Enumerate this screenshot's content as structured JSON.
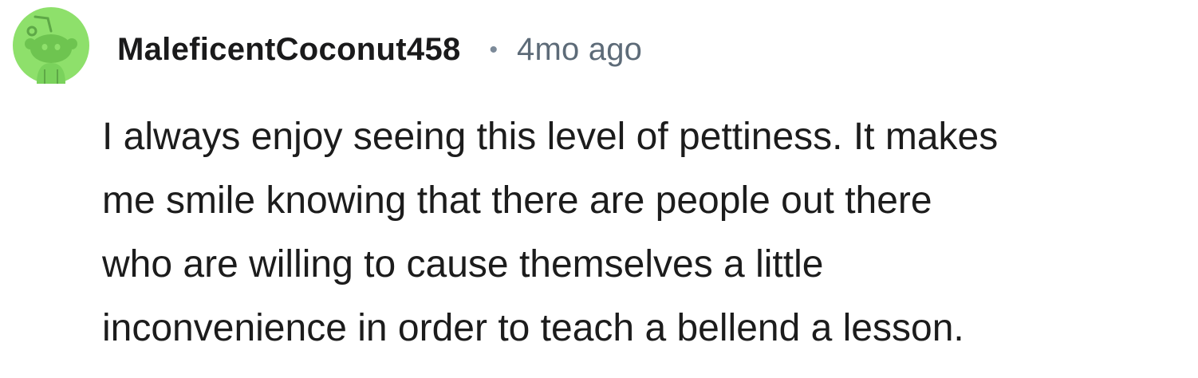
{
  "comment": {
    "avatar_icon": "reddit-snoo-avatar-icon",
    "avatar_color": "#8ee06b",
    "username": "MaleficentCoconut458",
    "separator": "•",
    "timestamp": "4mo ago",
    "body_lines": [
      "I always enjoy seeing this level of pettiness. It makes",
      "me smile knowing that there are people out there",
      "who are willing to cause themselves a little",
      "inconvenience in order to teach a bellend a lesson."
    ]
  }
}
